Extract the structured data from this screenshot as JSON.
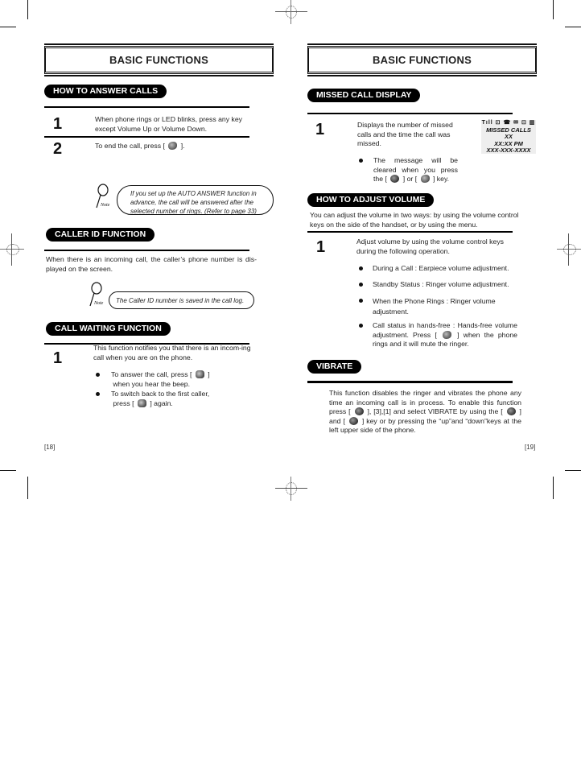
{
  "left_page": {
    "header": "BASIC FUNCTIONS",
    "page_number": "[18]",
    "answer_calls": {
      "title": "HOW TO ANSWER CALLS",
      "steps": [
        {
          "num": "1",
          "text": "When phone rings or LED blinks, press any key except Volume Up or Volume Down."
        },
        {
          "num": "2",
          "text_before": "To end the call, press [",
          "text_after": "]."
        }
      ],
      "note_label": "Note",
      "note": "If you set up the AUTO ANSWER function in advance, the call will be answered after the selected number of rings. (Refer to page 33)"
    },
    "caller_id": {
      "title": "CALLER ID FUNCTION",
      "text": "When there is an incoming call, the caller’s phone number is dis-played on the screen.",
      "note_label": "Note",
      "note": "The Caller ID number is saved in the call log."
    },
    "call_waiting": {
      "title": "CALL WAITING FUNCTION",
      "step_num": "1",
      "text": "This function notifies you that  there is an incom-ing call when you are on the phone.",
      "bullets": [
        {
          "before": "To answer the call, press [",
          "after": "]",
          "line2": "when you hear the beep."
        },
        {
          "before": "To switch back to the first caller,",
          "line2_before": "press [",
          "line2_after": "] again."
        }
      ]
    }
  },
  "right_page": {
    "header": "BASIC FUNCTIONS",
    "page_number": "[19]",
    "missed_call": {
      "title": "MISSED CALL DISPLAY",
      "step_num": "1",
      "text": "Displays the number of missed calls and the time the call was missed.",
      "bullet_before": "The message will be cleared when you press the [",
      "bullet_mid": "] or [",
      "bullet_after": "] key.",
      "lcd": {
        "status_icons": "Tıll ⊡ ☎  ✉ ⊡ ▥",
        "lines": [
          "MISSED CALLS",
          "XX",
          "XX:XX PM",
          "XXX-XXX-XXXX"
        ]
      }
    },
    "volume": {
      "title": "HOW TO ADJUST VOLUME",
      "intro": "You can adjust the volume in two ways:  by using the volume control keys on the side of the handset, or by using the menu.",
      "step_num": "1",
      "step_text": "Adjust volume by using the volume control keys during the following operation.",
      "bullets": [
        "During a Call : Earpiece volume adjustment.",
        "Standby Status : Ringer volume adjustment.",
        "When the Phone Rings : Ringer volume adjustment."
      ],
      "last_bullet_before": "Call status in hands-free : Hands-free volume adjustment. Press  [",
      "last_bullet_after": "]  when the phone rings and it will mute the ringer."
    },
    "vibrate": {
      "title": "VIBRATE",
      "text_a": "This function disables the ringer and vibrates the phone any time an incoming call is in process. To enable this function press [",
      "text_b": "], [3],[1] and select VIBRATE by using the  [",
      "text_c": "] and  [",
      "text_d": "] key  or by pressing the “up”and “down”keys at the left upper side of the phone."
    }
  }
}
